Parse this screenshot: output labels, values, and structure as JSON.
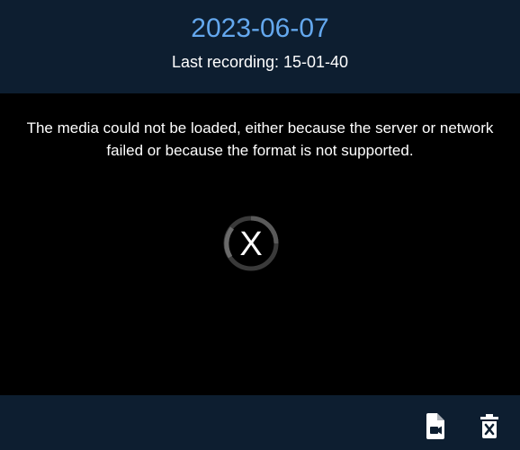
{
  "header": {
    "date": "2023-06-07",
    "last_recording": "Last recording: 15-01-40"
  },
  "video": {
    "error_message": "The media could not be loaded, either because the server or network failed or because the format is not supported.",
    "error_icon_glyph": "X"
  },
  "footer": {
    "download_icon": "file-video-icon",
    "delete_icon": "trash-x-icon"
  },
  "colors": {
    "background": "#0d1e30",
    "accent": "#64a8ee",
    "video_bg": "#000000",
    "text": "#ffffff"
  }
}
